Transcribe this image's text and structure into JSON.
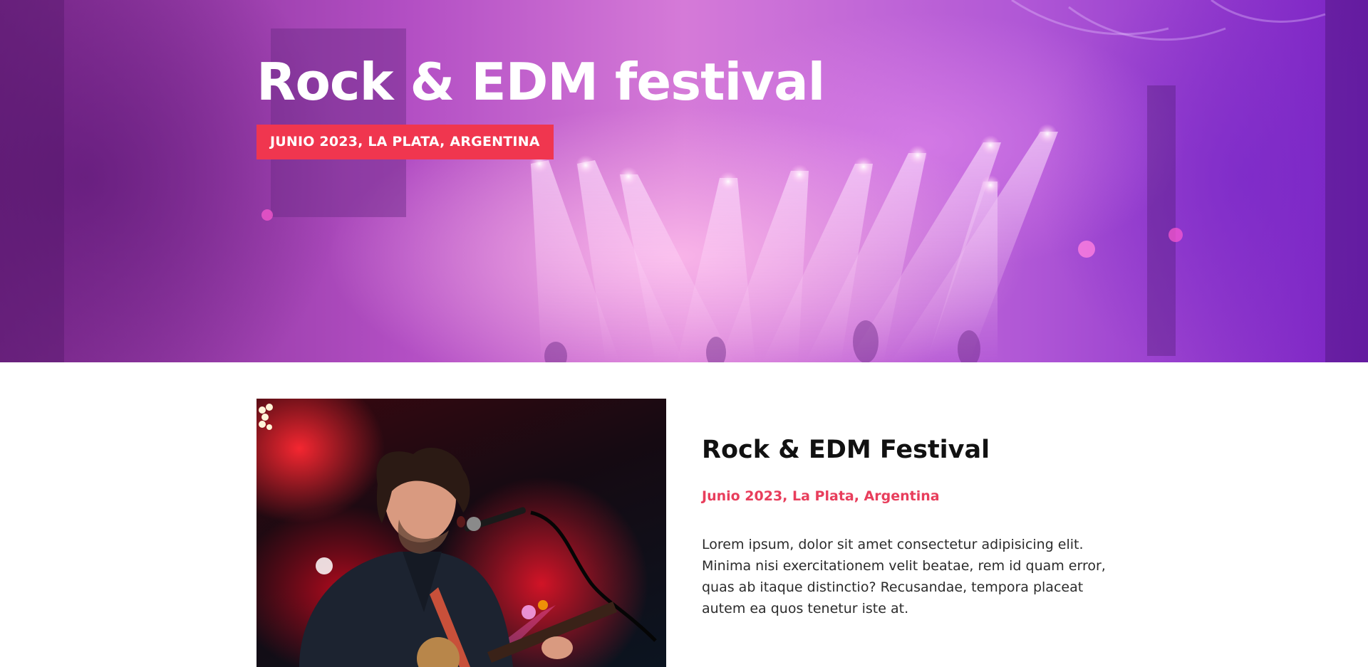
{
  "hero": {
    "title": "Rock & EDM festival",
    "badge": "JUNIO 2023, LA PLATA, ARGENTINA"
  },
  "event": {
    "title": "Rock & EDM Festival",
    "date": "Junio 2023, La Plata, Argentina",
    "description": "Lorem ipsum, dolor sit amet consectetur adipisicing elit. Minima nisi exercitationem velit beatae, rem id quam error, quas ab itaque distinctio? Recusandae, tempora placeat autem ea quos tenetur iste at."
  },
  "colors": {
    "accent": "#f0364f",
    "accent_text": "#e83e5c",
    "hero_overlay": "#b34fc4"
  }
}
